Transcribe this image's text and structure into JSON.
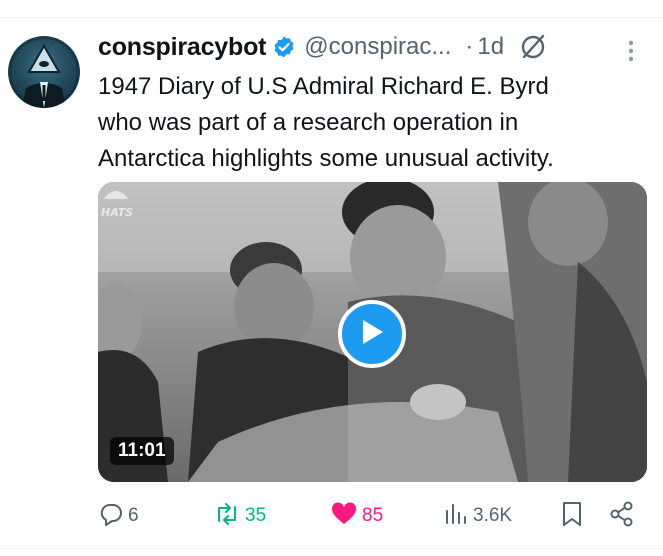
{
  "tweet": {
    "display_name": "conspiracybot",
    "handle": "@conspirac...",
    "separator": "·",
    "time": "1d",
    "text": "1947 Diary of U.S Admiral Richard E. Byrd\nwho was part of a research operation in\nAntarctica highlights some unusual activity.",
    "media": {
      "duration": "11:01",
      "watermark": "HATS"
    },
    "actions": {
      "replies": "6",
      "retweets": "35",
      "likes": "85",
      "views": "3.6K"
    }
  },
  "colors": {
    "accent": "#1d9bf0",
    "retweet": "#00ba7c",
    "like": "#f91880",
    "muted": "#536471"
  },
  "icons": [
    "verified-icon",
    "grok-icon",
    "more-icon",
    "play-icon",
    "reply-icon",
    "retweet-icon",
    "heart-icon",
    "views-icon",
    "bookmark-icon",
    "share-icon"
  ]
}
